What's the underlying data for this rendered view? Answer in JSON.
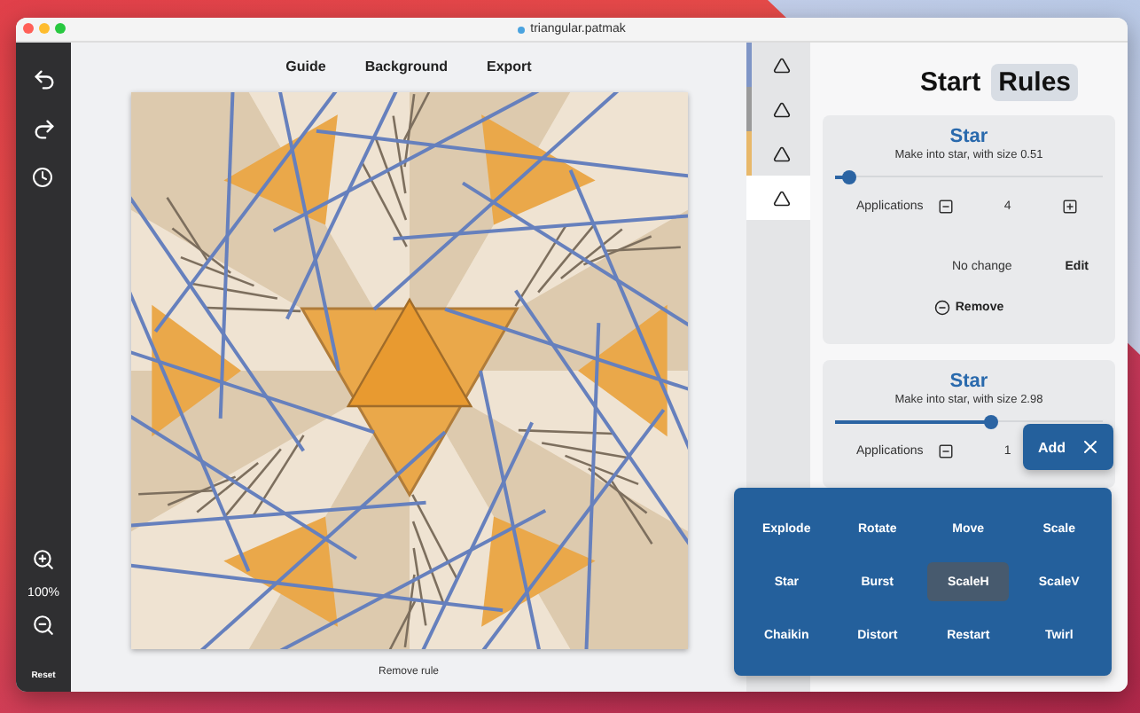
{
  "window": {
    "title": "triangular.patmak"
  },
  "left_toolbar": {
    "zoom": "100%",
    "reset": "Reset"
  },
  "top_menu": [
    "Guide",
    "Background",
    "Export"
  ],
  "canvas": {
    "caption": "Remove rule"
  },
  "rule_tabs": [
    {
      "color": "#7f95c6",
      "selected": false
    },
    {
      "color": "#9a9a9a",
      "selected": false
    },
    {
      "color": "#e8b86a",
      "selected": false
    },
    {
      "color": "#ffffff",
      "selected": true
    }
  ],
  "panel_tabs": [
    {
      "label": "Start",
      "selected": false
    },
    {
      "label": "Rules",
      "selected": true
    }
  ],
  "rules": [
    {
      "title": "Star",
      "description": "Make into star, with size 0.51",
      "level": 0.05,
      "applications_label": "Applications",
      "applications": "4",
      "status": "No change",
      "edit": "Edit",
      "remove": "Remove"
    },
    {
      "title": "Star",
      "description": "Make into star, with size 2.98",
      "level": 0.58,
      "applications_label": "Applications",
      "applications": "1"
    }
  ],
  "add_menu": {
    "label": "Add",
    "open": true,
    "options": [
      {
        "label": "Explode",
        "selected": false
      },
      {
        "label": "Rotate",
        "selected": false
      },
      {
        "label": "Move",
        "selected": false
      },
      {
        "label": "Scale",
        "selected": false
      },
      {
        "label": "Star",
        "selected": false
      },
      {
        "label": "Burst",
        "selected": false
      },
      {
        "label": "ScaleH",
        "selected": true
      },
      {
        "label": "ScaleV",
        "selected": false
      },
      {
        "label": "Chaikin",
        "selected": false
      },
      {
        "label": "Distort",
        "selected": false
      },
      {
        "label": "Restart",
        "selected": false
      },
      {
        "label": "Twirl",
        "selected": false
      }
    ]
  }
}
